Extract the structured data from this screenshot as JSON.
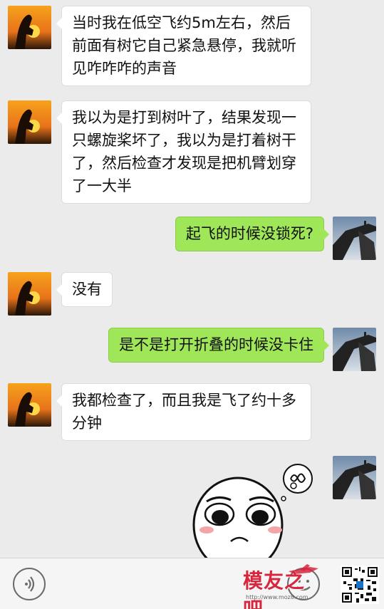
{
  "messages": [
    {
      "side": "in",
      "text": "当时我在低空飞约5m左右，然后前面有树它自己紧急悬停，我就听见咋咋咋的声音"
    },
    {
      "side": "in",
      "text": "我以为是打到树叶了，结果发现一只螺旋桨坏了，我以为是打着树干了，然后检查才发现是把机臂划穿了一大半"
    },
    {
      "side": "out",
      "text": "起飞的时候没锁死?"
    },
    {
      "side": "in",
      "text": "没有"
    },
    {
      "side": "out",
      "text": "是不是打开折叠的时候没卡住"
    },
    {
      "side": "in",
      "text": "我都检查了，而且我是飞了约十多分钟"
    },
    {
      "side": "out",
      "type": "sticker",
      "sticker": "worried-face-sticker"
    }
  ],
  "watermark": {
    "text": "模友之吧",
    "url": "http://www.moz8.com"
  },
  "colors": {
    "outgoing_bubble": "#9fe658",
    "incoming_bubble": "#ffffff",
    "background": "#ebebeb",
    "watermark": "#d7263d"
  },
  "icons": {
    "voice": "voice-icon",
    "emoji": "emoji-icon",
    "qr": "qr-code"
  }
}
